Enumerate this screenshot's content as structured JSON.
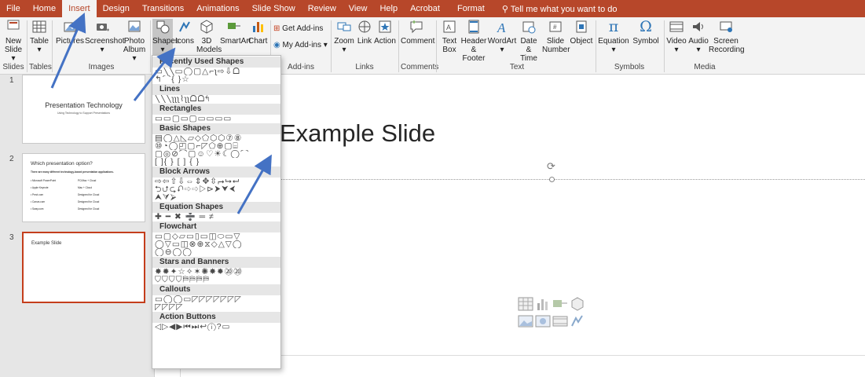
{
  "tabs": [
    "File",
    "Home",
    "Insert",
    "Design",
    "Transitions",
    "Animations",
    "Slide Show",
    "Review",
    "View",
    "Help",
    "Acrobat",
    "Format"
  ],
  "tell_me": "Tell me what you want to do",
  "ribbon": {
    "new_slide": "New\nSlide ▾",
    "table": "Table\n▾",
    "pictures": "Pictures",
    "screenshot": "Screenshot\n▾",
    "photo_album": "Photo\nAlbum ▾",
    "shapes": "Shapes\n▾",
    "icons": "Icons",
    "models": "3D\nModels ▾",
    "smartart": "SmartArt",
    "chart": "Chart",
    "get_addins": "Get Add-ins",
    "my_addins": "My Add-ins ▾",
    "zoom": "Zoom\n▾",
    "link": "Link",
    "action": "Action",
    "comment": "Comment",
    "text_box": "Text\nBox",
    "header_footer": "Header\n& Footer",
    "wordart": "WordArt\n▾",
    "date_time": "Date &\nTime",
    "slide_number": "Slide\nNumber",
    "object": "Object",
    "equation": "Equation\n▾",
    "symbol": "Symbol",
    "video": "Video\n▾",
    "audio": "Audio\n▾",
    "screen_recording": "Screen\nRecording",
    "groups": {
      "slides": "Slides",
      "tables": "Tables",
      "images": "Images",
      "addins": "Add-ins",
      "links": "Links",
      "comments": "Comments",
      "text": "Text",
      "symbols": "Symbols",
      "media": "Media"
    }
  },
  "shapes_menu": {
    "sections": [
      {
        "title": "Recently Used Shapes",
        "rows": [
          "▭╲╲▭◯▢△⌐ʅ⇨⇩ᗝ",
          "↰⌒{ }☆"
        ]
      },
      {
        "title": "Lines",
        "rows": [
          "╲╲╲ʅʅʅ⌇ʅʅᗝᗝ↰"
        ]
      },
      {
        "title": "Rectangles",
        "rows": [
          "▭▭▢▭▢▭▭▭▭"
        ]
      },
      {
        "title": "Basic Shapes",
        "rows": [
          "▤◯△◺▱◇⬠⬡⬡⑦⑧",
          "⑩◔◯◰▢⌐◸⬠⊕▢⌸",
          "▢◎⊘⌒▢☺♡☀☾◯⌒",
          "[ ]{ } [ ] { }"
        ]
      },
      {
        "title": "Block Arrows",
        "rows": [
          "⇨⇦⇧⇩⇔⇕✥⇳⮣⮡⮠",
          "⮌⮍⮎⮏⇨⇨▷⊳⮞⮟⮜",
          "⮝⮛⮚"
        ]
      },
      {
        "title": "Equation Shapes",
        "rows": [
          "✚ ━ ✖ ➗ ═ ≠"
        ]
      },
      {
        "title": "Flowchart",
        "rows": [
          "▭▢◇▱▭▯▭◫⬭▭▽",
          "◯▽▭◫⊗⊕⧖◇△▽◯",
          "◯⊖◯◯"
        ]
      },
      {
        "title": "Stars and Banners",
        "rows": [
          "✸✹✦☆✧✶✺✸✹⑳⑳",
          "⛉⛉⛉⛉⛿⛿⛿⛿"
        ]
      },
      {
        "title": "Callouts",
        "rows": [
          "▭◯◯▭◸◸◸◸◸◸◸",
          "◸◸◸◸"
        ]
      },
      {
        "title": "Action Buttons",
        "rows": [
          "◁▷◀▶⏮⏭↩ⓘ?▭"
        ]
      }
    ]
  },
  "slides": [
    {
      "num": "1",
      "title": "Presentation Technology",
      "subtitle": "Using Technology to Support Presentations"
    },
    {
      "num": "2",
      "title": "Which presentation option?",
      "intro": "There are many different technology-based presentation applications.",
      "rows": [
        [
          "• Microsoft PowerPoint",
          "PC/Mac + Cloud"
        ],
        [
          "• Apple Keynote",
          "Mac + Cloud"
        ],
        [
          "• Prezi.com",
          "Designed for Cloud"
        ],
        [
          "• Canva.com",
          "Designed for Cloud"
        ],
        [
          "• Sway.com",
          "Designed for Cloud"
        ]
      ]
    },
    {
      "num": "3",
      "title": "Example Slide"
    }
  ],
  "main_slide_title": "Example Slide",
  "colors": {
    "accent": "#b7472a",
    "arrow": "#4472c4",
    "selected_border": "#c43e1c"
  }
}
